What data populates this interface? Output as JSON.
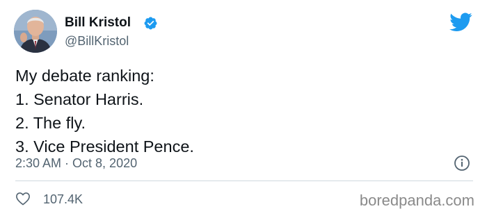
{
  "author": {
    "name": "Bill Kristol",
    "handle": "@BillKristol",
    "verified": true
  },
  "tweet": {
    "lines": [
      "My debate ranking:",
      "1. Senator Harris.",
      "2. The fly.",
      "3. Vice President Pence."
    ],
    "time": "2:30 AM · Oct 8, 2020",
    "likes": "107.4K"
  },
  "watermark": "boredpanda.com",
  "icons": {
    "verified": "verified-badge-icon",
    "platform": "twitter-bird-icon",
    "info": "info-icon",
    "like": "heart-icon"
  },
  "colors": {
    "accent": "#1d9bf0",
    "secondary_text": "#536471",
    "primary_text": "#0f1419",
    "divider": "#cfd9de"
  }
}
